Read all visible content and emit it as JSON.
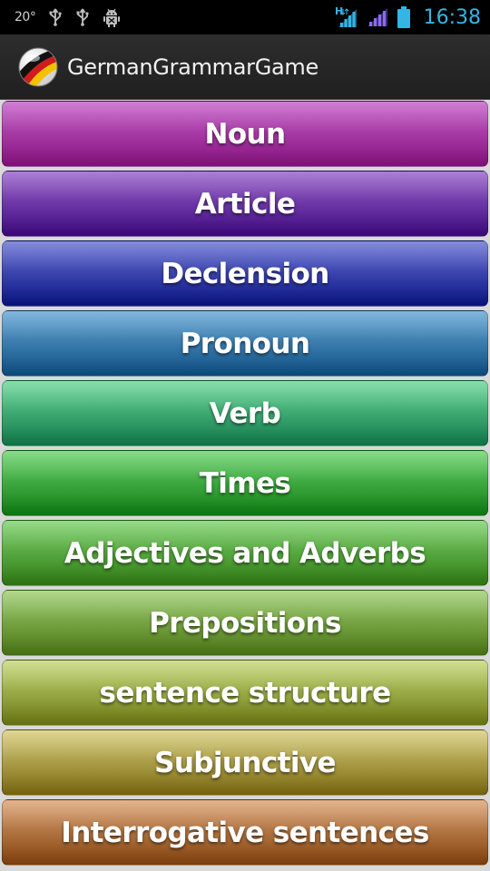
{
  "status_bar": {
    "temperature": "20°",
    "network_label": "H",
    "time": "16:38"
  },
  "action_bar": {
    "title": "GermanGrammarGame"
  },
  "menu": {
    "items": [
      {
        "label": "Noun",
        "top": "#c562c9",
        "bottom": "#87117f"
      },
      {
        "label": "Article",
        "top": "#9a63cc",
        "bottom": "#3e0a80"
      },
      {
        "label": "Declension",
        "top": "#6a73d4",
        "bottom": "#0a1485"
      },
      {
        "label": "Pronoun",
        "top": "#67a7d6",
        "bottom": "#0d4f83"
      },
      {
        "label": "Verb",
        "top": "#6cd79a",
        "bottom": "#107a4a"
      },
      {
        "label": "Times",
        "top": "#6ed46e",
        "bottom": "#0e7d12"
      },
      {
        "label": "Adjectives and Adverbs",
        "top": "#7fd26e",
        "bottom": "#2f7c12"
      },
      {
        "label": "Prepositions",
        "top": "#a0cf72",
        "bottom": "#4b7714"
      },
      {
        "label": "sentence structure",
        "top": "#c6d97a",
        "bottom": "#6c7a12"
      },
      {
        "label": "Subjunctive",
        "top": "#d8ce7e",
        "bottom": "#7c6a10"
      },
      {
        "label": "Interrogative sentences",
        "top": "#dba374",
        "bottom": "#84420c"
      }
    ]
  }
}
